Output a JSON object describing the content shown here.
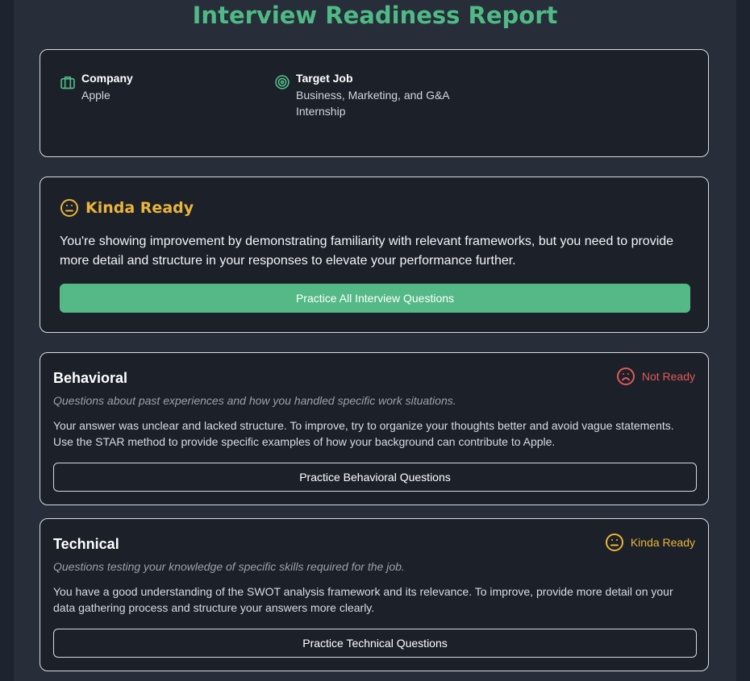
{
  "page_title": "Interview Readiness Report",
  "info": {
    "company_label": "Company",
    "company_value": "Apple",
    "job_label": "Target Job",
    "job_value": "Business, Marketing, and G&A Internship"
  },
  "overall": {
    "status": "Kinda Ready",
    "summary": "You're showing improvement by demonstrating familiarity with relevant frameworks, but you need to provide more detail and structure in your responses to elevate your performance further.",
    "button_label": "Practice All Interview Questions"
  },
  "categories": [
    {
      "title": "Behavioral",
      "status": "Not Ready",
      "description": "Questions about past experiences and how you handled specific work situations.",
      "feedback": "Your answer was unclear and lacked structure. To improve, try to organize your thoughts better and avoid vague statements. Use the STAR method to provide specific examples of how your background can contribute to Apple.",
      "button_label": "Practice Behavioral Questions"
    },
    {
      "title": "Technical",
      "status": "Kinda Ready",
      "description": "Questions testing your knowledge of specific skills required for the job.",
      "feedback": "You have a good understanding of the SWOT analysis framework and its relevance. To improve, provide more detail on your data gathering process and structure your answers more clearly.",
      "button_label": "Practice Technical Questions"
    }
  ],
  "colors": {
    "accent_green": "#4fba85",
    "button_green": "#55b987",
    "kinda_ready": "#e9b53a",
    "not_ready": "#e05a57",
    "background": "#1e2330",
    "card": "#1c2029"
  },
  "icons": {
    "company": "briefcase-icon",
    "job": "target-icon",
    "kinda_ready": "neutral-face-icon",
    "not_ready": "sad-face-icon"
  }
}
